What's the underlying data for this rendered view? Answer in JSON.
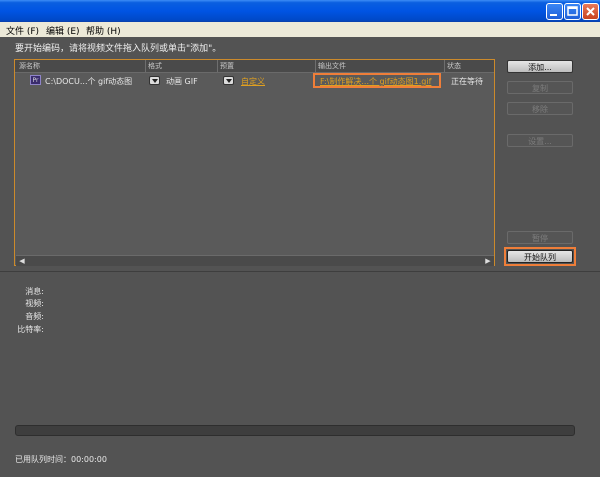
{
  "menu": {
    "file": "文件 (F)",
    "edit": "编辑 (E)",
    "help": "帮助 (H)"
  },
  "hint": "要开始编码，请将视频文件拖入队列或单击\"添加\"。",
  "queue": {
    "columns": [
      "源名称",
      "格式",
      "预置",
      "输出文件",
      "状态"
    ],
    "row": {
      "source": "C:\\DOCU...个 gif动态图",
      "format": "动画 GIF",
      "preset": "自定义",
      "output": "F:\\制作解决...个 gif动态图1.gif",
      "status": "正在等待"
    }
  },
  "buttons": {
    "add": "添加...",
    "duplicate": "复制",
    "remove": "移除",
    "settings": "设置...",
    "pause": "暂停",
    "start": "开始队列"
  },
  "info": {
    "message": "消息:",
    "video": "视频:",
    "audio": "音频:",
    "bitrate": "比特率:"
  },
  "elapsed": "已用队列时间：00:00:00",
  "colors": {
    "accent": "#ef7e39",
    "link": "#e0a020",
    "background": "#535353"
  }
}
